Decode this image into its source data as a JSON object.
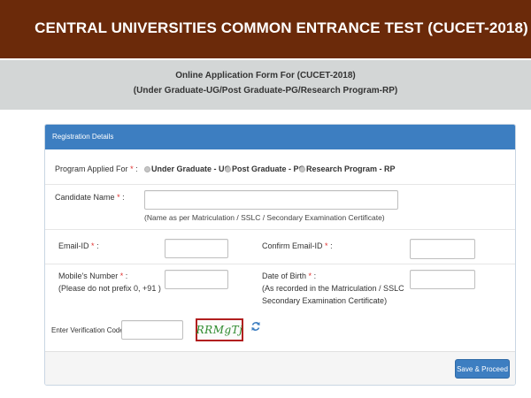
{
  "banner": {
    "title": "CENTRAL UNIVERSITIES COMMON ENTRANCE TEST (CUCET-2018)"
  },
  "subheader": {
    "line1": "Online Application Form For (CUCET-2018)",
    "line2": "(Under Graduate-UG/Post Graduate-PG/Research Program-RP)"
  },
  "panel": {
    "heading": "Registration Details",
    "program": {
      "label": "Program Applied For",
      "required_mark": "*",
      "colon": ":",
      "options": [
        "Under Graduate - UG",
        "Post Graduate - PG",
        "Research Program - RP"
      ]
    },
    "candidate_name": {
      "label": "Candidate Name",
      "required_mark": "*",
      "colon": ":",
      "value": "",
      "hint": "(Name as per Matriculation / SSLC / Secondary Examination Certificate)"
    },
    "email": {
      "label": "Email-ID",
      "required_mark": "*",
      "colon": ":",
      "value": ""
    },
    "confirm_email": {
      "label": "Confirm Email-ID",
      "required_mark": "*",
      "colon": ":",
      "value": ""
    },
    "mobile": {
      "label": "Mobile's Number",
      "required_mark": "*",
      "colon": ":",
      "note": "(Please do not prefix 0, +91 )",
      "value": ""
    },
    "dob": {
      "label": "Date of Birth",
      "required_mark": "*",
      "colon": ":",
      "note_line1": "(As recorded in the Matriculation / SSLC",
      "note_line2": "Secondary Examination Certificate)",
      "value": ""
    },
    "verification": {
      "label": "Enter Verification Code",
      "required_mark": "*",
      "colon": ":",
      "value": "",
      "captcha_text": "RRMgTj",
      "refresh_icon": "refresh-icon"
    },
    "submit_label": "Save & Proceed"
  },
  "colors": {
    "banner_bg": "#6b2a0a",
    "subheader_bg": "#d3d6d6",
    "panel_heading_bg": "#3d7ec1",
    "required": "#e0312f",
    "captcha_text": "#2c8a2c",
    "captcha_border": "#b21f1f"
  }
}
